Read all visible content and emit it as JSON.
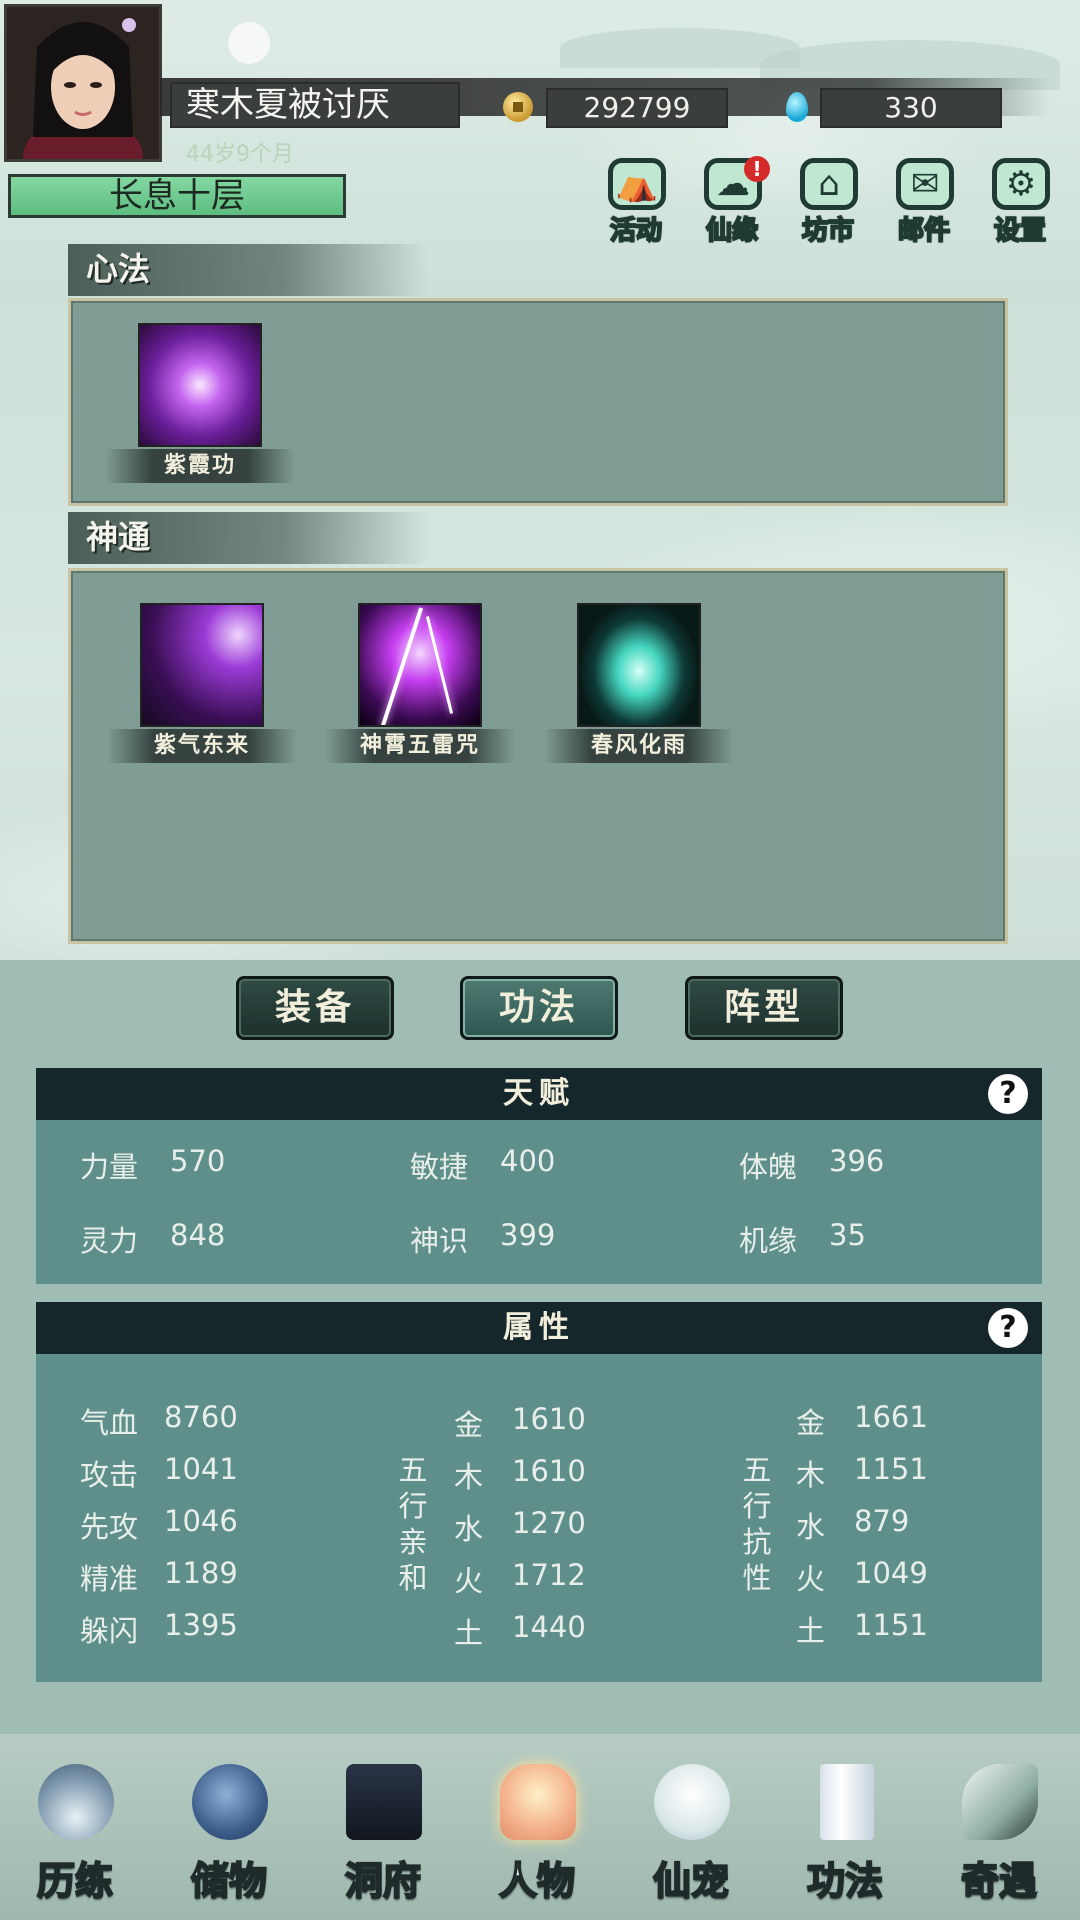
{
  "header": {
    "player_name": "寒木夏被讨厌",
    "age": "44岁9个月",
    "realm": "长息十层",
    "coins": "292799",
    "gems": "330"
  },
  "top_menu": [
    {
      "label": "活动",
      "icon": "activity-icon"
    },
    {
      "label": "仙缘",
      "icon": "fate-icon",
      "badge": "!"
    },
    {
      "label": "坊市",
      "icon": "market-icon"
    },
    {
      "label": "邮件",
      "icon": "mail-icon"
    },
    {
      "label": "设置",
      "icon": "settings-icon"
    }
  ],
  "xinfa": {
    "title": "心法",
    "skills": [
      {
        "name": "紫霞功"
      }
    ]
  },
  "shentong": {
    "title": "神通",
    "skills": [
      {
        "name": "紫气东来"
      },
      {
        "name": "神霄五雷咒"
      },
      {
        "name": "春风化雨"
      }
    ]
  },
  "tabs": [
    {
      "label": "装备",
      "active": false
    },
    {
      "label": "功法",
      "active": true
    },
    {
      "label": "阵型",
      "active": false
    }
  ],
  "talent": {
    "title": "天赋",
    "help": "?",
    "stats": [
      {
        "label": "力量",
        "value": "570"
      },
      {
        "label": "敏捷",
        "value": "400"
      },
      {
        "label": "体魄",
        "value": "396"
      },
      {
        "label": "灵力",
        "value": "848"
      },
      {
        "label": "神识",
        "value": "399"
      },
      {
        "label": "机缘",
        "value": "35"
      }
    ]
  },
  "attributes": {
    "title": "属性",
    "help": "?",
    "basic": [
      {
        "label": "气血",
        "value": "8760"
      },
      {
        "label": "攻击",
        "value": "1041"
      },
      {
        "label": "先攻",
        "value": "1046"
      },
      {
        "label": "精准",
        "value": "1189"
      },
      {
        "label": "躲闪",
        "value": "1395"
      }
    ],
    "affinity_title": [
      "五",
      "行",
      "亲",
      "和"
    ],
    "affinity": [
      {
        "label": "金",
        "value": "1610"
      },
      {
        "label": "木",
        "value": "1610"
      },
      {
        "label": "水",
        "value": "1270"
      },
      {
        "label": "火",
        "value": "1712"
      },
      {
        "label": "土",
        "value": "1440"
      }
    ],
    "resist_title": [
      "五",
      "行",
      "抗",
      "性"
    ],
    "resist": [
      {
        "label": "金",
        "value": "1661"
      },
      {
        "label": "木",
        "value": "1151"
      },
      {
        "label": "水",
        "value": "879"
      },
      {
        "label": "火",
        "value": "1049"
      },
      {
        "label": "土",
        "value": "1151"
      }
    ]
  },
  "bottom_nav": [
    {
      "label": "历练",
      "icon": "mountain-icon"
    },
    {
      "label": "储物",
      "icon": "bag-icon"
    },
    {
      "label": "洞府",
      "icon": "pagoda-icon"
    },
    {
      "label": "人物",
      "icon": "character-icon",
      "active": true
    },
    {
      "label": "仙宠",
      "icon": "pet-icon"
    },
    {
      "label": "功法",
      "icon": "scroll-icon"
    },
    {
      "label": "奇遇",
      "icon": "brush-icon"
    }
  ],
  "colors": {
    "accent": "#15272b",
    "panel": "#5f8f8a",
    "realm": "#6fcb8f",
    "badge": "#d52a2a"
  }
}
